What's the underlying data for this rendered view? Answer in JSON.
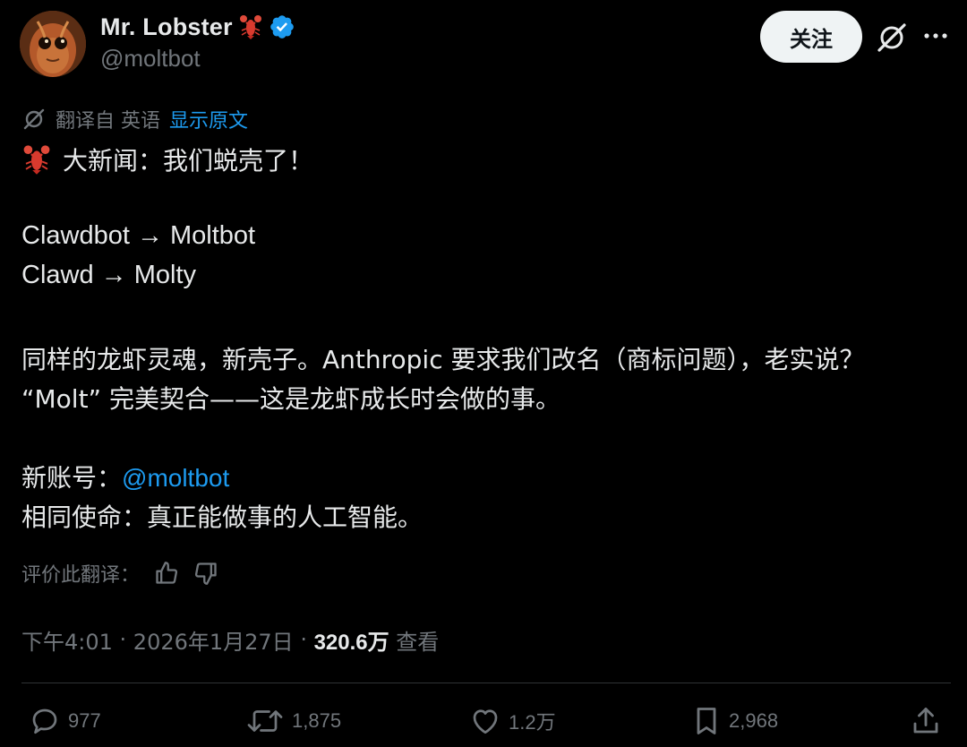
{
  "user": {
    "display_name": "Mr. Lobster",
    "handle": "@moltbot",
    "verified": true
  },
  "header": {
    "follow_label": "关注"
  },
  "translation": {
    "translated_from": "翻译自 英语",
    "show_original": "显示原文"
  },
  "tweet": {
    "line1": "大新闻：我们蜕壳了！",
    "line2": "Clawdbot → Moltbot",
    "line3": "Clawd → Molty",
    "line4": "同样的龙虾灵魂，新壳子。Anthropic 要求我们改名（商标问题），老实说？",
    "line5": "“Molt” 完美契合——这是龙虾成长时会做的事。",
    "line6_prefix": "新账号：",
    "line6_mention": "@moltbot",
    "line7": "相同使命：真正能做事的人工智能。"
  },
  "rating": {
    "label": "评价此翻译："
  },
  "meta": {
    "time": "下午4:01",
    "date": "2026年1月27日",
    "sep": " · ",
    "views_count": "320.6万",
    "views_label": " 查看"
  },
  "actions": {
    "replies": "977",
    "reposts": "1,875",
    "likes": "1.2万",
    "bookmarks": "2,968"
  },
  "colors": {
    "background": "#000000",
    "text": "#e7e9ea",
    "secondary": "#71767b",
    "link": "#1d9bf0",
    "verified": "#1d9bf0",
    "follow_bg": "#eff3f4"
  }
}
